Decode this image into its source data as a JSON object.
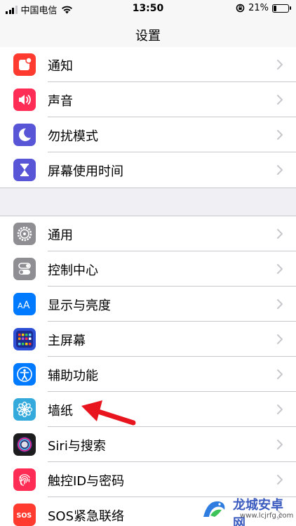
{
  "status_bar": {
    "carrier": "中国电信",
    "time": "13:50",
    "battery_text": "21%"
  },
  "nav": {
    "title": "设置"
  },
  "groups": [
    {
      "items": [
        {
          "label": "通知",
          "icon": "notifications-icon",
          "color": "#ff3b30"
        },
        {
          "label": "声音",
          "icon": "sounds-icon",
          "color": "#ff2d55"
        },
        {
          "label": "勿扰模式",
          "icon": "moon-icon",
          "color": "#5856d6"
        },
        {
          "label": "屏幕使用时间",
          "icon": "hourglass-icon",
          "color": "#5856d6"
        }
      ]
    },
    {
      "items": [
        {
          "label": "通用",
          "icon": "gear-icon",
          "color": "#8e8e93"
        },
        {
          "label": "控制中心",
          "icon": "toggles-icon",
          "color": "#8e8e93"
        },
        {
          "label": "显示与亮度",
          "icon": "display-aa-icon",
          "color": "#007aff"
        },
        {
          "label": "主屏幕",
          "icon": "home-screen-grid-icon",
          "color": "#2c4fd6"
        },
        {
          "label": "辅助功能",
          "icon": "accessibility-icon",
          "color": "#007aff"
        },
        {
          "label": "墙纸",
          "icon": "wallpaper-flower-icon",
          "color": "#34aadc"
        },
        {
          "label": "Siri与搜索",
          "icon": "siri-icon",
          "color": "#1c1c1e"
        },
        {
          "label": "触控ID与密码",
          "icon": "fingerprint-icon",
          "color": "#ff2d55"
        },
        {
          "label": "SOS紧急联络",
          "icon": "sos-icon",
          "color": "#ff3b30"
        }
      ]
    }
  ],
  "watermark": {
    "text": "龙城安卓网",
    "url": "www.lcjrfg.com"
  }
}
